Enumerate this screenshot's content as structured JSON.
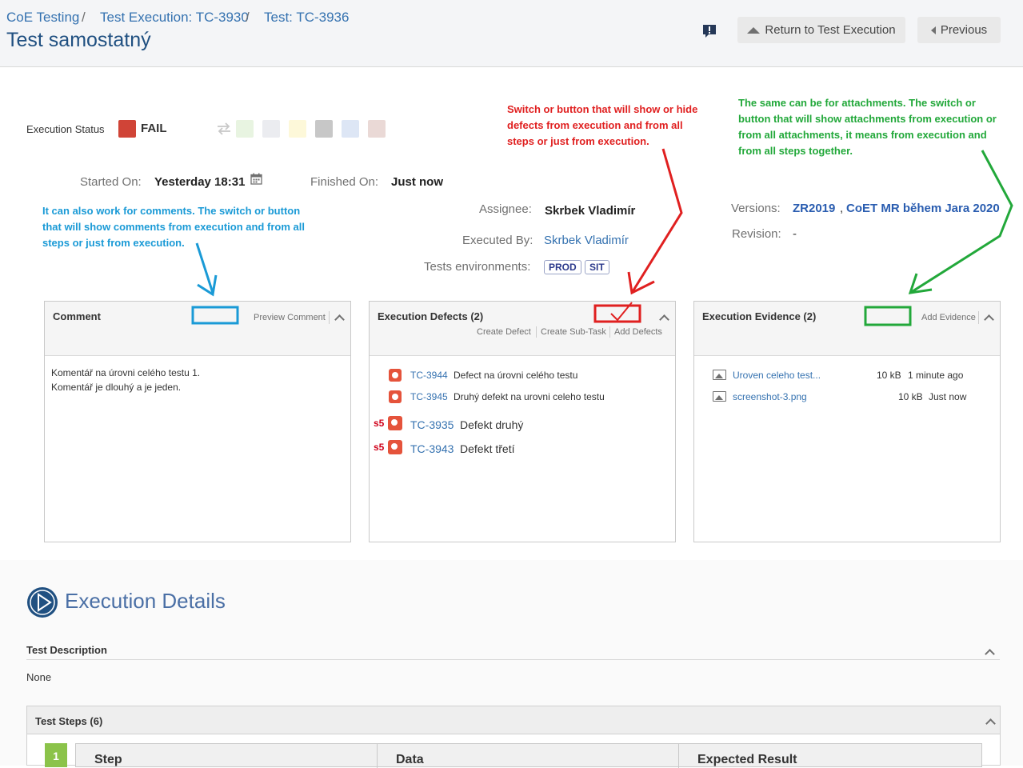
{
  "breadcrumb": {
    "item1": "CoE Testing",
    "sep": "/",
    "item2": "Test Execution: TC-3930",
    "item3": "Test: TC-3936"
  },
  "page_title": "Test samostatný",
  "header_buttons": {
    "return_label": "Return to Test Execution",
    "previous_label": "Previous"
  },
  "execution": {
    "status_label": "Execution Status",
    "status_value": "FAIL",
    "status_color": "#d04437",
    "started_label": "Started On:",
    "started_value": "Yesterday 18:31",
    "finished_label": "Finished On:",
    "finished_value": "Just now",
    "assignee_label": "Assignee:",
    "assignee_value": "Skrbek Vladimír",
    "executed_by_label": "Executed By:",
    "executed_by_value": "Skrbek Vladimír",
    "environments_label": "Tests environments:",
    "environments": [
      "PROD",
      "SIT"
    ],
    "versions_label": "Versions:",
    "version1": "ZR2019",
    "version_sep": ",",
    "version2": "CoET MR během Jara 2020",
    "revision_label": "Revision:",
    "revision_value": "-"
  },
  "status_swatch_colors": [
    "#e8f4e1",
    "#ebecf0",
    "#fdf8d9",
    "#c7c7c7",
    "#dde6f5",
    "#ead9d6"
  ],
  "comment_panel": {
    "title": "Comment",
    "action": "Preview Comment",
    "line1": "Komentář na úrovni celého testu 1.",
    "line2": "Komentář je dlouhý a je jeden."
  },
  "defects_panel": {
    "title": "Execution Defects (2)",
    "actions": [
      "Create Defect",
      "Create Sub-Task",
      "Add Defects"
    ],
    "defects": [
      {
        "key": "TC-3944",
        "summary": "Defect na úrovni celého testu"
      },
      {
        "key": "TC-3945",
        "summary": "Druhý defekt na urovni celeho testu"
      }
    ],
    "step_defects": [
      {
        "step": "s5",
        "key": "TC-3935",
        "summary": "Defekt druhý"
      },
      {
        "step": "s5",
        "key": "TC-3943",
        "summary": "Defekt třetí"
      }
    ]
  },
  "evidence_panel": {
    "title": "Execution Evidence (2)",
    "action": "Add Evidence",
    "files": [
      {
        "name": "Uroven celeho test...",
        "size": "10 kB",
        "time": "1 minute ago"
      },
      {
        "name": "screenshot-3.png",
        "size": "10 kB",
        "time": "Just now"
      }
    ]
  },
  "annotations": {
    "blue": "It can also work for comments. The switch or button that will show comments from execution and from all steps or just from execution.",
    "red": "Switch or button that will show or hide defects from execution and from all steps or just from execution.",
    "green": "The same can be for attachments. The switch or button that will show attachments from execution or from all attachments, it means from execution and from all steps together."
  },
  "annotation_colors": {
    "blue": "#1a9ad6",
    "red": "#e02020",
    "green": "#22a83a"
  },
  "details": {
    "heading": "Execution Details",
    "description_label": "Test Description",
    "description_value": "None",
    "steps_label": "Test Steps (6)",
    "step_number": "1",
    "columns": [
      "Step",
      "Data",
      "Expected Result"
    ]
  }
}
